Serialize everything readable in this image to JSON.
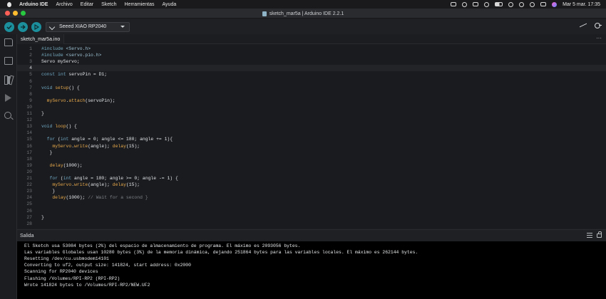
{
  "menubar": {
    "app_name": "Arduino IDE",
    "items": [
      "Archivo",
      "Editar",
      "Sketch",
      "Herramientas",
      "Ayuda"
    ],
    "clock": "Mar 5 mar.  17:35"
  },
  "window": {
    "title": "sketch_mar5a | Arduino IDE 2.2.1"
  },
  "toolbar": {
    "verify_icon": "check-icon",
    "upload_icon": "arrow-right-icon",
    "debug_icon": "debug-icon",
    "board_name": "Seeed XIAO RP2040"
  },
  "tab": {
    "filename": "sketch_mar5a.ino",
    "more": "···"
  },
  "editor": {
    "active_line": 4,
    "lines": [
      "#include <Servo.h>",
      "#include <servo.pio.h>",
      "Servo myServo;",
      "",
      "const int servoPin = D1;",
      "",
      "void setup() {",
      "",
      "  myServo.attach(servoPin);",
      "",
      "}",
      "",
      "void loop() {",
      "",
      "  for (int angle = 0; angle <= 180; angle += 1){",
      "    myServo.write(angle); delay(15);",
      "   }",
      "",
      "   delay(1000);",
      "",
      "   for (int angle = 180; angle >= 0; angle -= 1) {",
      "    myServo.write(angle); delay(15);",
      "    }",
      "    delay(1000); // Wait for a second }",
      "",
      "",
      "}",
      ""
    ]
  },
  "output": {
    "title": "Salida",
    "lines": [
      "El Sketch usa 53084 bytes (2%) del espacio de almacenamiento de programa. El máximo es 2093056 bytes.",
      "Las variables Globales usan 10280 bytes (3%) de la memoria dinámica, dejando 251864 bytes para las variables locales. El máximo es 262144 bytes.",
      "Resetting /dev/cu.usbmodem14101",
      "Converting to uf2, output size: 141824, start address: 0x2000",
      "Scanning for RP2040 devices",
      "Flashing /Volumes/RPI-RP2 (RPI-RP2)",
      "Wrote 141824 bytes to /Volumes/RPI-RP2/NEW.UF2"
    ]
  },
  "colors": {
    "accent": "#1c8f9d",
    "keyword": "#6fa8c4",
    "function": "#e6a84c",
    "comment": "#7b8086"
  }
}
